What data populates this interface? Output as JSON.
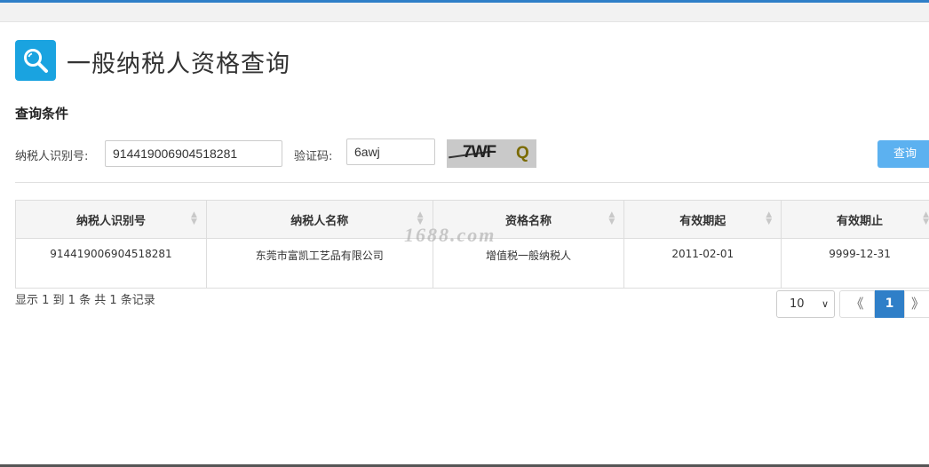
{
  "title": "一般纳税人资格查询",
  "section_title": "查询条件",
  "form": {
    "taxpayer_id_label": "纳税人识别号:",
    "taxpayer_id_value": "914419006904518281",
    "captcha_label": "验证码:",
    "captcha_value": "6awj",
    "captcha_image_text": "7WF",
    "captcha_image_q": "Q",
    "query_button": "查询"
  },
  "table": {
    "columns": [
      "纳税人识别号",
      "纳税人名称",
      "资格名称",
      "有效期起",
      "有效期止"
    ],
    "rows": [
      [
        "914419006904518281",
        "东莞市富凯工艺品有限公司",
        "增值税一般纳税人",
        "2011-02-01",
        "9999-12-31"
      ]
    ]
  },
  "watermark": "1688.com",
  "footer": {
    "records_text": "显示 1 到 1 条 共 1 条记录",
    "page_size": "10",
    "prev": "《",
    "current_page": "1",
    "next": "》"
  },
  "colors": {
    "accent": "#2f7fc8",
    "button": "#5cb1f0",
    "icon_bg": "#1aa3e0"
  }
}
